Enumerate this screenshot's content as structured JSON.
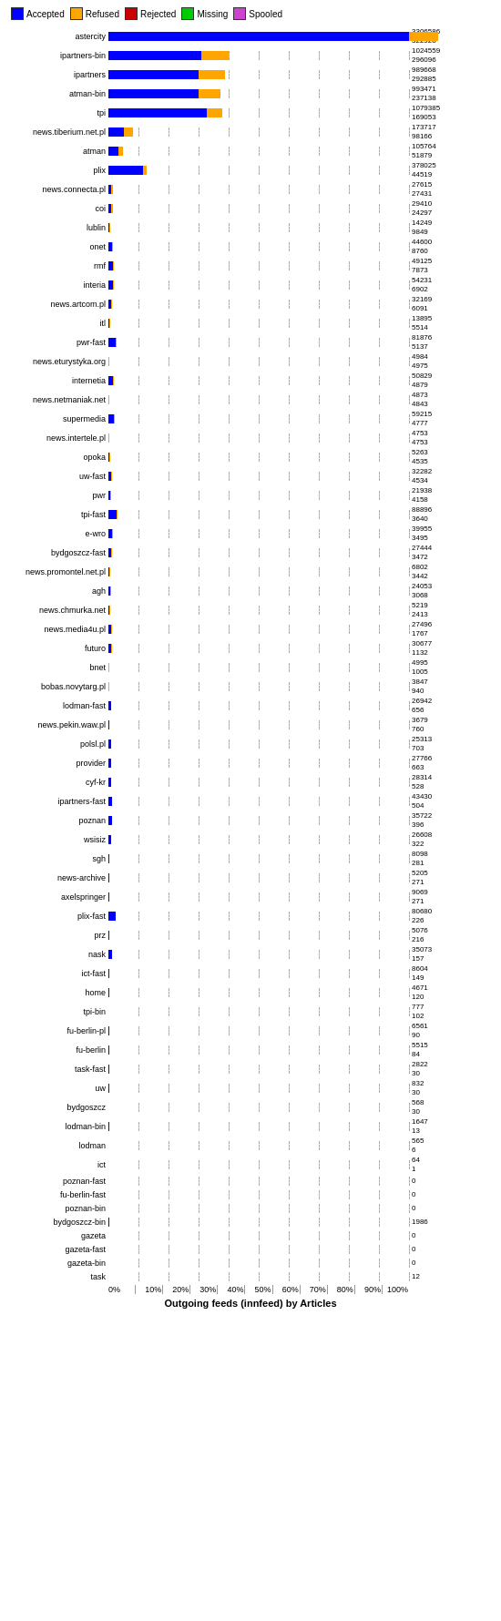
{
  "legend": [
    {
      "label": "Accepted",
      "color": "#0000ff",
      "class": "bar-accepted"
    },
    {
      "label": "Refused",
      "color": "#ffa500",
      "class": "bar-refused"
    },
    {
      "label": "Rejected",
      "color": "#cc0000",
      "class": "bar-rejected"
    },
    {
      "label": "Missing",
      "color": "#00cc00",
      "class": "bar-missing"
    },
    {
      "label": "Spooled",
      "color": "#cc44cc",
      "class": "bar-spooled"
    }
  ],
  "max_val": 3306586,
  "x_labels": [
    "0%",
    "10%",
    "20%",
    "30%",
    "40%",
    "50%",
    "60%",
    "70%",
    "80%",
    "90%",
    "100%"
  ],
  "x_title": "Outgoing feeds (innfeed) by Articles",
  "rows": [
    {
      "label": "astercity",
      "accepted": 3306586,
      "refused": 322928,
      "rejected": 0,
      "missing": 0,
      "spooled": 0,
      "nums": "3306586\n322928"
    },
    {
      "label": "ipartners-bin",
      "accepted": 1024559,
      "refused": 296096,
      "rejected": 0,
      "missing": 0,
      "spooled": 0,
      "nums": "1024559\n296096"
    },
    {
      "label": "ipartners",
      "accepted": 989668,
      "refused": 292885,
      "rejected": 0,
      "missing": 0,
      "spooled": 0,
      "nums": "989668\n292885"
    },
    {
      "label": "atman-bin",
      "accepted": 993471,
      "refused": 237138,
      "rejected": 0,
      "missing": 0,
      "spooled": 0,
      "nums": "993471\n237138"
    },
    {
      "label": "tpi",
      "accepted": 1079385,
      "refused": 169053,
      "rejected": 0,
      "missing": 0,
      "spooled": 0,
      "nums": "1079385\n169053"
    },
    {
      "label": "news.tiberium.net.pl",
      "accepted": 173717,
      "refused": 98166,
      "rejected": 0,
      "missing": 0,
      "spooled": 0,
      "nums": "173717\n98166"
    },
    {
      "label": "atman",
      "accepted": 105764,
      "refused": 51879,
      "rejected": 0,
      "missing": 0,
      "spooled": 0,
      "nums": "105764\n51879"
    },
    {
      "label": "plix",
      "accepted": 378025,
      "refused": 44519,
      "rejected": 0,
      "missing": 0,
      "spooled": 0,
      "nums": "378025\n44519"
    },
    {
      "label": "news.connecta.pl",
      "accepted": 27615,
      "refused": 27431,
      "rejected": 0,
      "missing": 0,
      "spooled": 0,
      "nums": "27615\n27431"
    },
    {
      "label": "coi",
      "accepted": 29410,
      "refused": 24297,
      "rejected": 0,
      "missing": 0,
      "spooled": 0,
      "nums": "29410\n24297"
    },
    {
      "label": "lublin",
      "accepted": 14249,
      "refused": 9849,
      "rejected": 0,
      "missing": 0,
      "spooled": 0,
      "nums": "14249\n9849"
    },
    {
      "label": "onet",
      "accepted": 44600,
      "refused": 8760,
      "rejected": 0,
      "missing": 0,
      "spooled": 0,
      "nums": "44600\n8760"
    },
    {
      "label": "rmf",
      "accepted": 49125,
      "refused": 7873,
      "rejected": 0,
      "missing": 0,
      "spooled": 0,
      "nums": "49125\n7873"
    },
    {
      "label": "interia",
      "accepted": 54231,
      "refused": 6902,
      "rejected": 0,
      "missing": 0,
      "spooled": 0,
      "nums": "54231\n6902"
    },
    {
      "label": "news.artcom.pl",
      "accepted": 32169,
      "refused": 6091,
      "rejected": 0,
      "missing": 0,
      "spooled": 0,
      "nums": "32169\n6091"
    },
    {
      "label": "itl",
      "accepted": 13895,
      "refused": 5514,
      "rejected": 0,
      "missing": 0,
      "spooled": 0,
      "nums": "13895\n5514"
    },
    {
      "label": "pwr-fast",
      "accepted": 81876,
      "refused": 5137,
      "rejected": 0,
      "missing": 0,
      "spooled": 0,
      "nums": "81876\n5137"
    },
    {
      "label": "news.eturystyka.org",
      "accepted": 4984,
      "refused": 4975,
      "rejected": 0,
      "missing": 0,
      "spooled": 0,
      "nums": "4984\n4975"
    },
    {
      "label": "internetia",
      "accepted": 50829,
      "refused": 4879,
      "rejected": 0,
      "missing": 0,
      "spooled": 0,
      "nums": "50829\n4879"
    },
    {
      "label": "news.netmaniak.net",
      "accepted": 4873,
      "refused": 4843,
      "rejected": 0,
      "missing": 0,
      "spooled": 0,
      "nums": "4873\n4843"
    },
    {
      "label": "supermedia",
      "accepted": 59215,
      "refused": 4777,
      "rejected": 0,
      "missing": 0,
      "spooled": 0,
      "nums": "59215\n4777"
    },
    {
      "label": "news.intertele.pl",
      "accepted": 4753,
      "refused": 4753,
      "rejected": 0,
      "missing": 0,
      "spooled": 0,
      "nums": "4753\n4753"
    },
    {
      "label": "opoka",
      "accepted": 5263,
      "refused": 4535,
      "rejected": 0,
      "missing": 0,
      "spooled": 0,
      "nums": "5263\n4535"
    },
    {
      "label": "uw-fast",
      "accepted": 32282,
      "refused": 4534,
      "rejected": 0,
      "missing": 0,
      "spooled": 0,
      "nums": "32282\n4534"
    },
    {
      "label": "pwr",
      "accepted": 21938,
      "refused": 4158,
      "rejected": 0,
      "missing": 0,
      "spooled": 0,
      "nums": "21938\n4158"
    },
    {
      "label": "tpi-fast",
      "accepted": 88896,
      "refused": 3640,
      "rejected": 0,
      "missing": 0,
      "spooled": 0,
      "nums": "88896\n3640"
    },
    {
      "label": "e-wro",
      "accepted": 39955,
      "refused": 3495,
      "rejected": 0,
      "missing": 0,
      "spooled": 0,
      "nums": "39955\n3495"
    },
    {
      "label": "bydgoszcz-fast",
      "accepted": 27444,
      "refused": 3472,
      "rejected": 0,
      "missing": 0,
      "spooled": 0,
      "nums": "27444\n3472"
    },
    {
      "label": "news.promontel.net.pl",
      "accepted": 6802,
      "refused": 3442,
      "rejected": 0,
      "missing": 0,
      "spooled": 0,
      "nums": "6802\n3442"
    },
    {
      "label": "agh",
      "accepted": 24053,
      "refused": 3068,
      "rejected": 0,
      "missing": 0,
      "spooled": 0,
      "nums": "24053\n3068"
    },
    {
      "label": "news.chmurka.net",
      "accepted": 5219,
      "refused": 2413,
      "rejected": 0,
      "missing": 0,
      "spooled": 0,
      "nums": "5219\n2413"
    },
    {
      "label": "news.media4u.pl",
      "accepted": 27496,
      "refused": 1767,
      "rejected": 0,
      "missing": 0,
      "spooled": 0,
      "nums": "27496\n1767"
    },
    {
      "label": "futuro",
      "accepted": 30677,
      "refused": 1132,
      "rejected": 0,
      "missing": 0,
      "spooled": 0,
      "nums": "30677\n1132"
    },
    {
      "label": "bnet",
      "accepted": 4995,
      "refused": 1005,
      "rejected": 0,
      "missing": 0,
      "spooled": 0,
      "nums": "4995\n1005"
    },
    {
      "label": "bobas.novytarg.pl",
      "accepted": 3847,
      "refused": 940,
      "rejected": 0,
      "missing": 0,
      "spooled": 0,
      "nums": "3847\n940"
    },
    {
      "label": "lodman-fast",
      "accepted": 26942,
      "refused": 656,
      "rejected": 0,
      "missing": 0,
      "spooled": 0,
      "nums": "26942\n656"
    },
    {
      "label": "news.pekin.waw.pl",
      "accepted": 3679,
      "refused": 760,
      "rejected": 0,
      "missing": 0,
      "spooled": 0,
      "nums": "3679\n760"
    },
    {
      "label": "polsl.pl",
      "accepted": 25313,
      "refused": 703,
      "rejected": 0,
      "missing": 0,
      "spooled": 0,
      "nums": "25313\n703"
    },
    {
      "label": "provider",
      "accepted": 27766,
      "refused": 663,
      "rejected": 0,
      "missing": 0,
      "spooled": 0,
      "nums": "27766\n663"
    },
    {
      "label": "cyf-kr",
      "accepted": 28314,
      "refused": 528,
      "rejected": 0,
      "missing": 0,
      "spooled": 0,
      "nums": "28314\n528"
    },
    {
      "label": "ipartners-fast",
      "accepted": 43430,
      "refused": 504,
      "rejected": 0,
      "missing": 0,
      "spooled": 0,
      "nums": "43430\n504"
    },
    {
      "label": "poznan",
      "accepted": 35722,
      "refused": 396,
      "rejected": 0,
      "missing": 0,
      "spooled": 0,
      "nums": "35722\n396"
    },
    {
      "label": "wsisiz",
      "accepted": 26608,
      "refused": 322,
      "rejected": 0,
      "missing": 0,
      "spooled": 0,
      "nums": "26608\n322"
    },
    {
      "label": "sgh",
      "accepted": 8098,
      "refused": 281,
      "rejected": 0,
      "missing": 0,
      "spooled": 0,
      "nums": "8098\n281"
    },
    {
      "label": "news-archive",
      "accepted": 5205,
      "refused": 271,
      "rejected": 0,
      "missing": 0,
      "spooled": 0,
      "nums": "5205\n271"
    },
    {
      "label": "axelspringer",
      "accepted": 9069,
      "refused": 271,
      "rejected": 0,
      "missing": 0,
      "spooled": 0,
      "nums": "9069\n271"
    },
    {
      "label": "plix-fast",
      "accepted": 80680,
      "refused": 226,
      "rejected": 0,
      "missing": 0,
      "spooled": 0,
      "nums": "80680\n226"
    },
    {
      "label": "prz",
      "accepted": 5076,
      "refused": 216,
      "rejected": 0,
      "missing": 0,
      "spooled": 0,
      "nums": "5076\n216"
    },
    {
      "label": "nask",
      "accepted": 35073,
      "refused": 157,
      "rejected": 0,
      "missing": 0,
      "spooled": 0,
      "nums": "35073\n157"
    },
    {
      "label": "ict-fast",
      "accepted": 8604,
      "refused": 149,
      "rejected": 0,
      "missing": 0,
      "spooled": 0,
      "nums": "8604\n149"
    },
    {
      "label": "home",
      "accepted": 4671,
      "refused": 120,
      "rejected": 0,
      "missing": 0,
      "spooled": 0,
      "nums": "4671\n120"
    },
    {
      "label": "tpi-bin",
      "accepted": 777,
      "refused": 102,
      "rejected": 0,
      "missing": 0,
      "spooled": 0,
      "nums": "777\n102"
    },
    {
      "label": "fu-berlin-pl",
      "accepted": 6561,
      "refused": 90,
      "rejected": 0,
      "missing": 0,
      "spooled": 0,
      "nums": "6561\n90"
    },
    {
      "label": "fu-berlin",
      "accepted": 5515,
      "refused": 84,
      "rejected": 0,
      "missing": 0,
      "spooled": 0,
      "nums": "5515\n84"
    },
    {
      "label": "task-fast",
      "accepted": 2822,
      "refused": 30,
      "rejected": 0,
      "missing": 0,
      "spooled": 0,
      "nums": "2822\n30"
    },
    {
      "label": "uw",
      "accepted": 832,
      "refused": 30,
      "rejected": 0,
      "missing": 0,
      "spooled": 0,
      "nums": "832\n30"
    },
    {
      "label": "bydgoszcz",
      "accepted": 568,
      "refused": 30,
      "rejected": 0,
      "missing": 0,
      "spooled": 0,
      "nums": "568\n30"
    },
    {
      "label": "lodman-bin",
      "accepted": 1647,
      "refused": 13,
      "rejected": 0,
      "missing": 0,
      "spooled": 0,
      "nums": "1647\n13"
    },
    {
      "label": "lodman",
      "accepted": 565,
      "refused": 6,
      "rejected": 0,
      "missing": 0,
      "spooled": 0,
      "nums": "565\n6"
    },
    {
      "label": "ict",
      "accepted": 64,
      "refused": 1,
      "rejected": 0,
      "missing": 0,
      "spooled": 0,
      "nums": "64\n1"
    },
    {
      "label": "poznan-fast",
      "accepted": 0,
      "refused": 0,
      "rejected": 0,
      "missing": 0,
      "spooled": 0,
      "nums": "0"
    },
    {
      "label": "fu-berlin-fast",
      "accepted": 0,
      "refused": 0,
      "rejected": 0,
      "missing": 0,
      "spooled": 0,
      "nums": "0"
    },
    {
      "label": "poznan-bin",
      "accepted": 0,
      "refused": 0,
      "rejected": 0,
      "missing": 0,
      "spooled": 0,
      "nums": "0"
    },
    {
      "label": "bydgoszcz-bin",
      "accepted": 1986,
      "refused": 0,
      "rejected": 0,
      "missing": 0,
      "spooled": 0,
      "nums": "1986"
    },
    {
      "label": "gazeta",
      "accepted": 0,
      "refused": 0,
      "rejected": 0,
      "missing": 0,
      "spooled": 0,
      "nums": "0"
    },
    {
      "label": "gazeta-fast",
      "accepted": 0,
      "refused": 0,
      "rejected": 0,
      "missing": 0,
      "spooled": 0,
      "nums": "0"
    },
    {
      "label": "gazeta-bin",
      "accepted": 0,
      "refused": 0,
      "rejected": 0,
      "missing": 0,
      "spooled": 0,
      "nums": "0"
    },
    {
      "label": "task",
      "accepted": 12,
      "refused": 0,
      "rejected": 0,
      "missing": 0,
      "spooled": 0,
      "nums": "12"
    }
  ]
}
